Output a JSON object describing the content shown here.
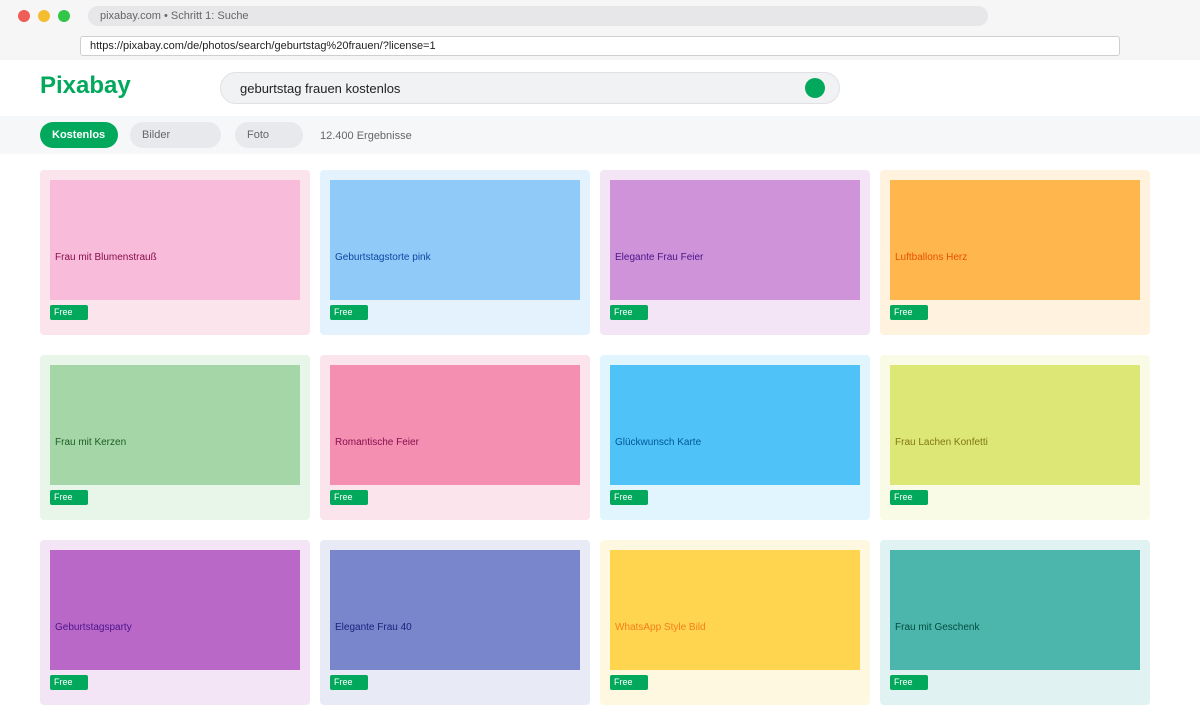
{
  "browser": {
    "tab_title": "pixabay.com • Schritt 1: Suche",
    "url": "https://pixabay.com/de/photos/search/geburtstag%20frauen/?license=1"
  },
  "header": {
    "logo": "Pixabay",
    "search_value": "geburtstag frauen kostenlos"
  },
  "filters": {
    "active": "Kostenlos",
    "type": "Bilder",
    "kind": "Foto",
    "result_count": "12.400 Ergebnisse"
  },
  "colors": {
    "brand": "#02a95c"
  },
  "results": [
    {
      "label": "Frau mit Blumenstrauß",
      "badge": "Free",
      "card_bg": "#fbe4ec",
      "thumb_bg": "#f8bbd9",
      "text_color": "#880e4f"
    },
    {
      "label": "Geburtstagstorte pink",
      "badge": "Free",
      "card_bg": "#e3f2fd",
      "thumb_bg": "#90caf9",
      "text_color": "#0d47a1"
    },
    {
      "label": "Elegante Frau Feier",
      "badge": "Free",
      "card_bg": "#f3e5f5",
      "thumb_bg": "#ce93d8",
      "text_color": "#4a148c"
    },
    {
      "label": "Luftballons Herz",
      "badge": "Free",
      "card_bg": "#fff3e0",
      "thumb_bg": "#ffb74d",
      "text_color": "#e65100"
    },
    {
      "label": "Frau mit Kerzen",
      "badge": "Free",
      "card_bg": "#e8f5e9",
      "thumb_bg": "#a5d6a7",
      "text_color": "#1b5e20"
    },
    {
      "label": "Romantische Feier",
      "badge": "Free",
      "card_bg": "#fce4ec",
      "thumb_bg": "#f48fb1",
      "text_color": "#880e4f"
    },
    {
      "label": "Glückwunsch Karte",
      "badge": "Free",
      "card_bg": "#e1f5fe",
      "thumb_bg": "#4fc3f7",
      "text_color": "#01579b"
    },
    {
      "label": "Frau Lachen Konfetti",
      "badge": "Free",
      "card_bg": "#f9fbe7",
      "thumb_bg": "#dce775",
      "text_color": "#827717"
    },
    {
      "label": "Geburtstagsparty",
      "badge": "Free",
      "card_bg": "#f3e5f5",
      "thumb_bg": "#ba68c8",
      "text_color": "#4a148c"
    },
    {
      "label": "Elegante Frau 40",
      "badge": "Free",
      "card_bg": "#e8eaf6",
      "thumb_bg": "#7986cb",
      "text_color": "#1a237e"
    },
    {
      "label": "WhatsApp Style Bild",
      "badge": "Free",
      "card_bg": "#fff8e1",
      "thumb_bg": "#ffd54f",
      "text_color": "#f57f17"
    },
    {
      "label": "Frau mit Geschenk",
      "badge": "Free",
      "card_bg": "#e0f2f1",
      "thumb_bg": "#4db6ac",
      "text_color": "#004d40"
    }
  ]
}
